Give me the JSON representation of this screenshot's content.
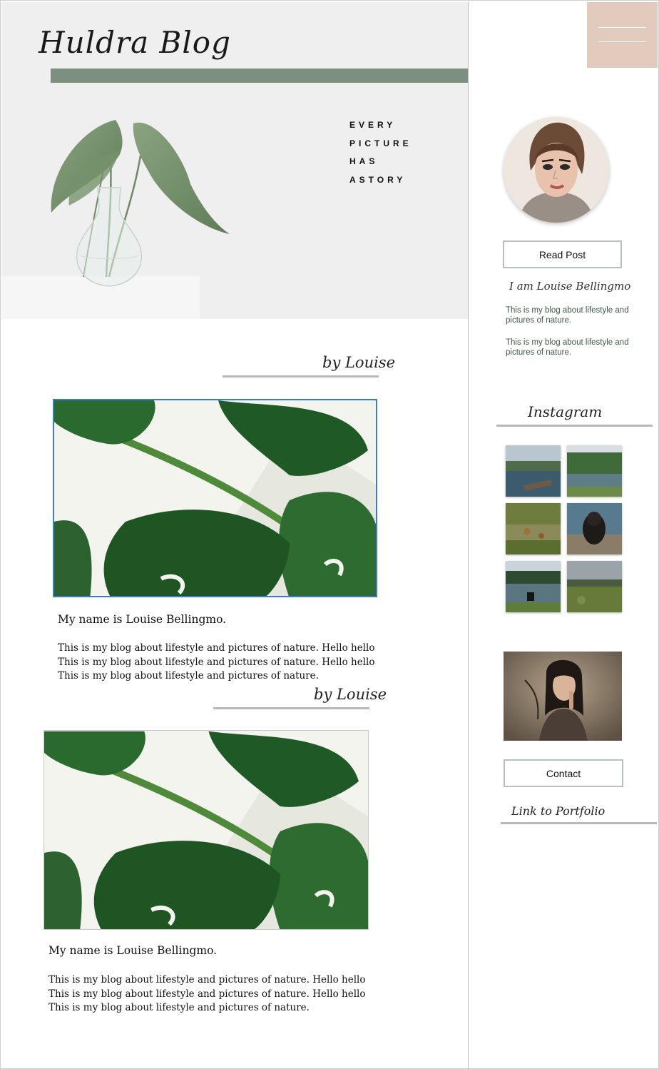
{
  "header": {
    "blog_title": "Huldra Blog",
    "tagline": [
      "EVERY",
      "PICTURE",
      "HAS",
      "ASTORY"
    ]
  },
  "colors": {
    "accent_green": "#7d8f7f",
    "menu_beige": "#e2cbbd",
    "rule_grey": "#b4b9be",
    "about_text_green": "#3e5a45",
    "selection_blue": "#3b7bd4"
  },
  "sidebar": {
    "read_post_label": "Read Post",
    "about_title": "I am Louise Bellingmo",
    "about_paragraphs": [
      "This is my blog about lifestyle and pictures of nature.",
      "This is my blog about lifestyle and pictures of nature."
    ],
    "instagram_title": "Instagram",
    "contact_label": "Contact",
    "portfolio_link": "Link to Portfolio"
  },
  "posts": [
    {
      "byline": "by Louise",
      "heading": "My name is Louise Bellingmo.",
      "body": [
        "This is my blog about lifestyle and pictures of nature. Hello hello",
        "This is my blog about lifestyle and pictures of nature. Hello hello",
        "This is my blog about lifestyle and pictures of nature."
      ]
    },
    {
      "byline": "by Louise",
      "heading": "My name is Louise Bellingmo.",
      "body": [
        "This is my blog about lifestyle and pictures of nature. Hello hello",
        "This is my blog about lifestyle and pictures of nature. Hello hello",
        "This is my blog about lifestyle and pictures of nature."
      ]
    }
  ]
}
